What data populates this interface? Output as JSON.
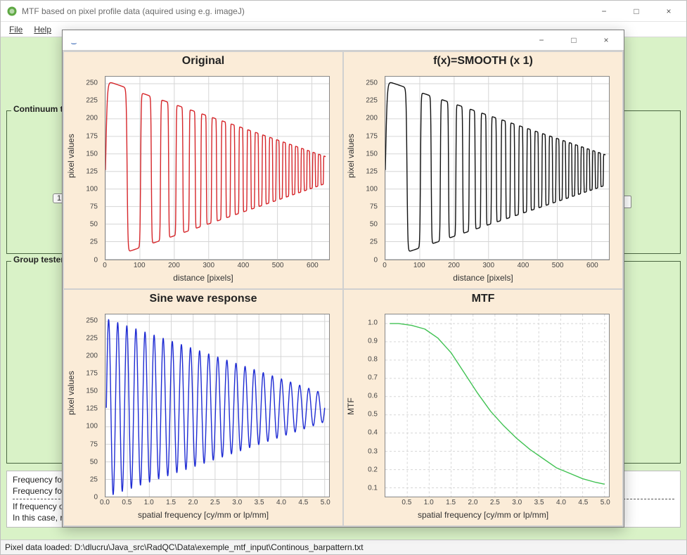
{
  "colors": {
    "red": "#d6262a",
    "black": "#111",
    "blue": "#1e2bd3",
    "green": "#41c253"
  },
  "main_window": {
    "title": "MTF based on pixel profile data (aquired using e.g. imageJ)",
    "menu": {
      "file": "File",
      "file_u": "F",
      "help": "Help",
      "help_u": "H"
    },
    "section_top_label": "Continuum tes",
    "section_mid_label": "Group tester d",
    "badge_text": "1",
    "notes": {
      "l1": "Frequency for",
      "l2": "Frequency for",
      "l3": "If frequency of",
      "l4": "In this case, results are not concludent!"
    },
    "status": "Pixel data loaded: D:\\dlucru\\Java_src\\RadQC\\Data\\exemple_mtf_input\\Continous_barpattern.txt",
    "btn_min": "−",
    "btn_max": "□",
    "btn_close": "×"
  },
  "child_window": {
    "title": "",
    "btn_min": "−",
    "btn_max": "□",
    "btn_close": "×"
  },
  "chart_data": [
    {
      "id": "original",
      "type": "line",
      "title": "Original",
      "xlabel": "distance [pixels]",
      "ylabel": "pixel values",
      "xlim": [
        0,
        650
      ],
      "ylim": [
        0,
        260
      ],
      "xticks": [
        0,
        100,
        200,
        300,
        400,
        500,
        600
      ],
      "yticks": [
        0,
        25,
        50,
        75,
        100,
        125,
        150,
        175,
        200,
        225,
        250
      ],
      "color": "#d6262a",
      "signal": {
        "kind": "chirp_square",
        "xmin": 0,
        "xmax": 640,
        "low": 0,
        "high": 255,
        "mid": 127,
        "f0": 0.005,
        "f1": 0.065,
        "amp_end_ratio": 0.15
      }
    },
    {
      "id": "smooth",
      "type": "line",
      "title": "f(x)=SMOOTH (x 1)",
      "xlabel": "distance [pixels]",
      "ylabel": "pixel values",
      "xlim": [
        0,
        650
      ],
      "ylim": [
        0,
        260
      ],
      "xticks": [
        0,
        100,
        200,
        300,
        400,
        500,
        600
      ],
      "yticks": [
        0,
        25,
        50,
        75,
        100,
        125,
        150,
        175,
        200,
        225,
        250
      ],
      "color": "#111",
      "signal": {
        "kind": "chirp_square",
        "xmin": 0,
        "xmax": 640,
        "low": 0,
        "high": 255,
        "mid": 127,
        "f0": 0.005,
        "f1": 0.065,
        "amp_end_ratio": 0.17
      }
    },
    {
      "id": "sine",
      "type": "line",
      "title": "Sine wave response",
      "xlabel": "spatial frequency [cy/mm or lp/mm]",
      "ylabel": "pixel values",
      "xlim": [
        0,
        5.1
      ],
      "ylim": [
        0,
        260
      ],
      "xticks": [
        0.0,
        0.5,
        1.0,
        1.5,
        2.0,
        2.5,
        3.0,
        3.5,
        4.0,
        4.5,
        5.0
      ],
      "xtick_labels": [
        "0.0",
        "0.5",
        "1.0",
        "1.5",
        "2.0",
        "2.5",
        "3.0",
        "3.5",
        "4.0",
        "4.5",
        "5.0"
      ],
      "yticks": [
        0,
        25,
        50,
        75,
        100,
        125,
        150,
        175,
        200,
        225,
        250
      ],
      "color": "#1e2bd3",
      "signal": {
        "kind": "sine_decay",
        "xmin": 0.02,
        "xmax": 5.0,
        "mid": 127,
        "amp0": 127,
        "amp1": 20,
        "cycles": 24
      }
    },
    {
      "id": "mtf",
      "type": "line",
      "title": "MTF",
      "xlabel": "spatial frequency [cy/mm or lp/mm]",
      "ylabel": "MTF",
      "xlim": [
        0,
        5.1
      ],
      "ylim": [
        0.05,
        1.05
      ],
      "xticks": [
        0.5,
        1.0,
        1.5,
        2.0,
        2.5,
        3.0,
        3.5,
        4.0,
        4.5,
        5.0
      ],
      "xtick_labels": [
        "0.5",
        "1.0",
        "1.5",
        "2.0",
        "2.5",
        "3.0",
        "3.5",
        "4.0",
        "4.5",
        "5.0"
      ],
      "yticks": [
        0.1,
        0.2,
        0.3,
        0.4,
        0.5,
        0.6,
        0.7,
        0.8,
        0.9,
        1.0
      ],
      "ytick_labels": [
        "0.1",
        "0.2",
        "0.3",
        "0.4",
        "0.5",
        "0.6",
        "0.7",
        "0.8",
        "0.9",
        "1.0"
      ],
      "color": "#41c253",
      "grid_dashed": true,
      "x": [
        0.1,
        0.3,
        0.6,
        0.9,
        1.2,
        1.5,
        1.8,
        2.1,
        2.4,
        2.7,
        3.0,
        3.3,
        3.6,
        3.9,
        4.2,
        4.5,
        4.8,
        5.0
      ],
      "y": [
        1.0,
        1.0,
        0.99,
        0.97,
        0.92,
        0.84,
        0.73,
        0.62,
        0.52,
        0.44,
        0.37,
        0.31,
        0.26,
        0.21,
        0.18,
        0.15,
        0.13,
        0.12
      ]
    }
  ]
}
